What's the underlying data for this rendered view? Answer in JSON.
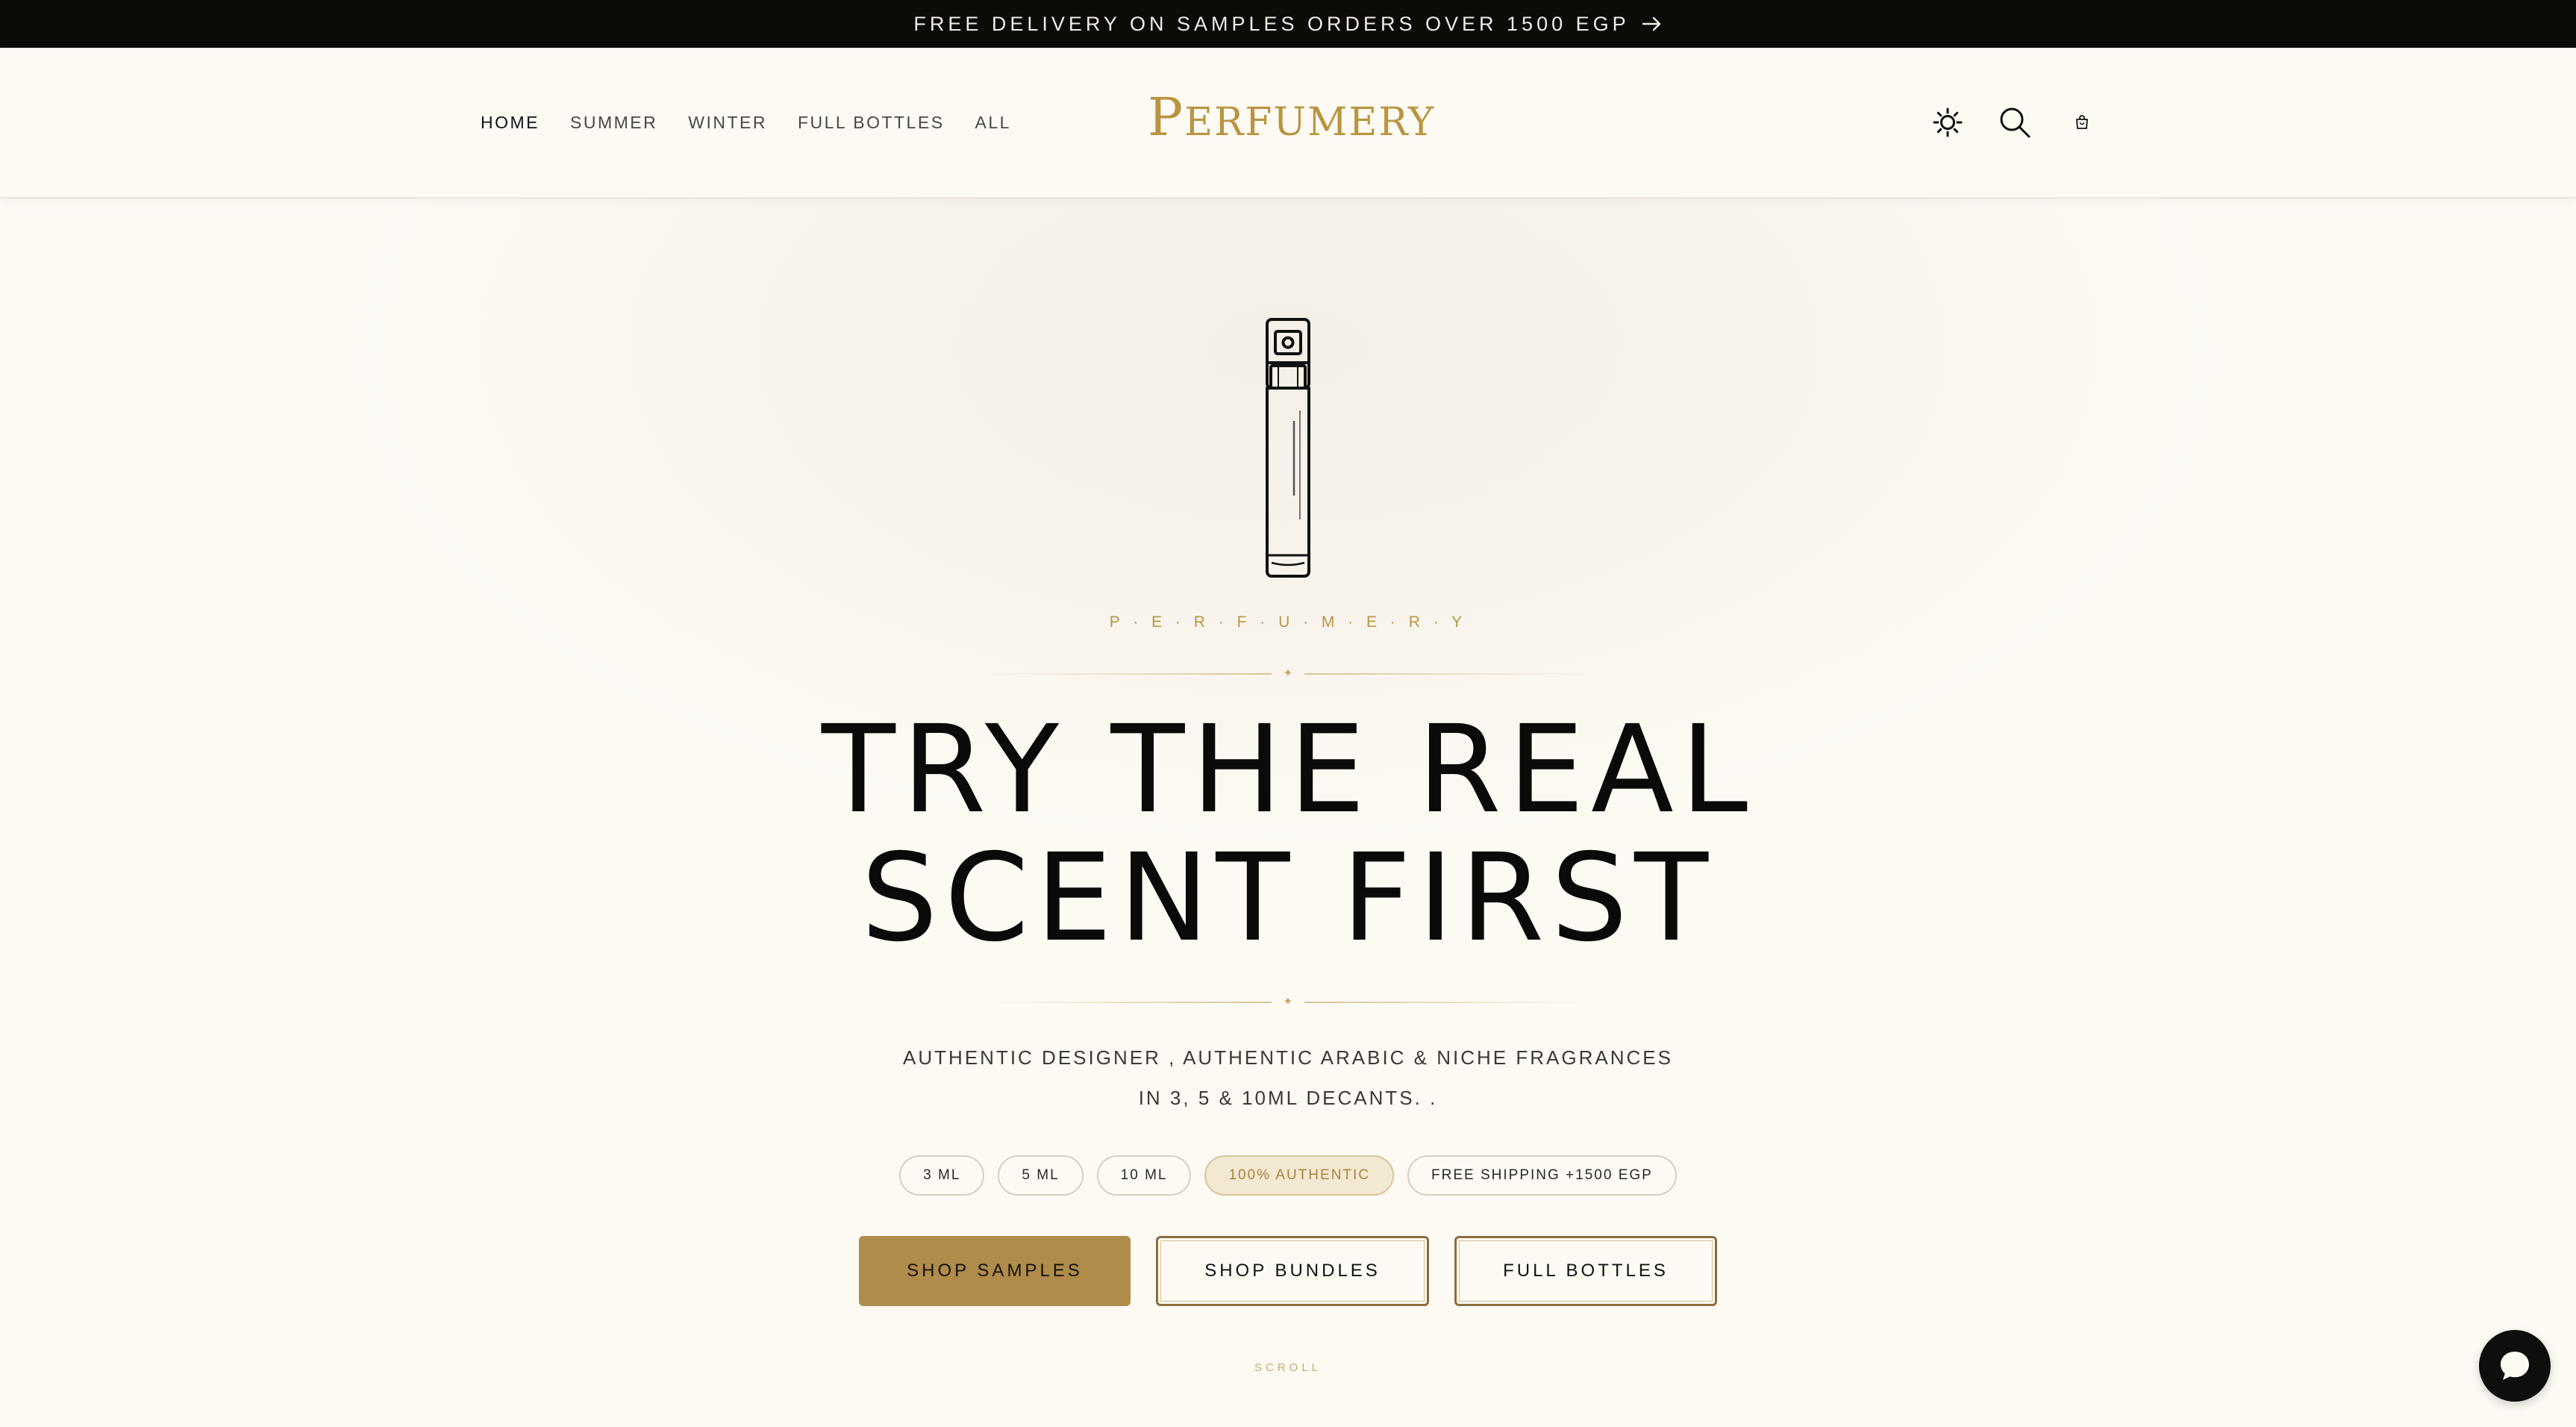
{
  "announcement": {
    "text": "FREE DELIVERY ON SAMPLES ORDERS OVER 1500 EGP",
    "icon": "arrow-right-icon"
  },
  "header": {
    "nav": [
      {
        "label": "HOME",
        "active": true
      },
      {
        "label": "SUMMER",
        "active": false
      },
      {
        "label": "WINTER",
        "active": false
      },
      {
        "label": "FULL BOTTLES",
        "active": false
      },
      {
        "label": "ALL",
        "active": false
      }
    ],
    "logo_first": "P",
    "logo_rest": "ERFUMERY",
    "icons": [
      "sun-icon",
      "search-icon",
      "cart-icon"
    ]
  },
  "hero": {
    "eyebrow": "P · E · R · F · U · M · E · R · Y",
    "headline_line1": "TRY THE REAL",
    "headline_line2": "SCENT FIRST",
    "sub_line1": "AUTHENTIC DESIGNER , AUTHENTIC ARABIC & NICHE FRAGRANCES",
    "sub_line2": "IN 3, 5 & 10ML DECANTS. .",
    "pills": [
      "3 ML",
      "5 ML",
      "10 ML",
      "100% AUTHENTIC",
      "FREE SHIPPING +1500 EGP"
    ],
    "buttons": {
      "primary": "SHOP SAMPLES",
      "secondary": "SHOP BUNDLES",
      "tertiary": "FULL BOTTLES"
    },
    "scroll": "SCROLL"
  },
  "colors": {
    "background": "#fdfaf4",
    "announcement_bg": "#0d0b08",
    "accent_gold": "#b9953f",
    "primary_button": "#b08c4a"
  }
}
